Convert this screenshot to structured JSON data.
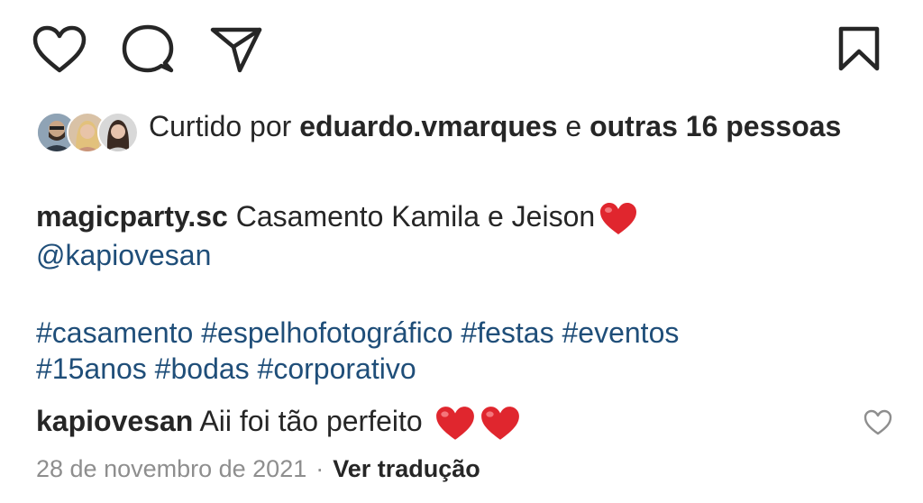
{
  "actions": {
    "like_icon": "heart-icon",
    "comment_icon": "comment-icon",
    "share_icon": "paper-plane-icon",
    "save_icon": "bookmark-icon"
  },
  "likes": {
    "prefix": "Curtido por",
    "user": "eduardo.vmarques",
    "conjunction": "e",
    "others": "outras 16 pessoas"
  },
  "caption": {
    "username": "magicparty.sc",
    "text": "Casamento Kamila e Jeison",
    "mention": "@kapiovesan",
    "hashtags_line1": "#casamento #espelhofotográfico #festas #eventos",
    "hashtags_line2": "#15anos #bodas #corporativo"
  },
  "comment": {
    "username": "kapiovesan",
    "text": "Aii foi tão perfeito"
  },
  "meta": {
    "date": "28 de novembro de 2021",
    "separator": "·",
    "translate": "Ver tradução"
  },
  "colors": {
    "text": "#262626",
    "link": "#1f4e79",
    "muted": "#8e8e8e",
    "heart_red": "#e0262e"
  }
}
